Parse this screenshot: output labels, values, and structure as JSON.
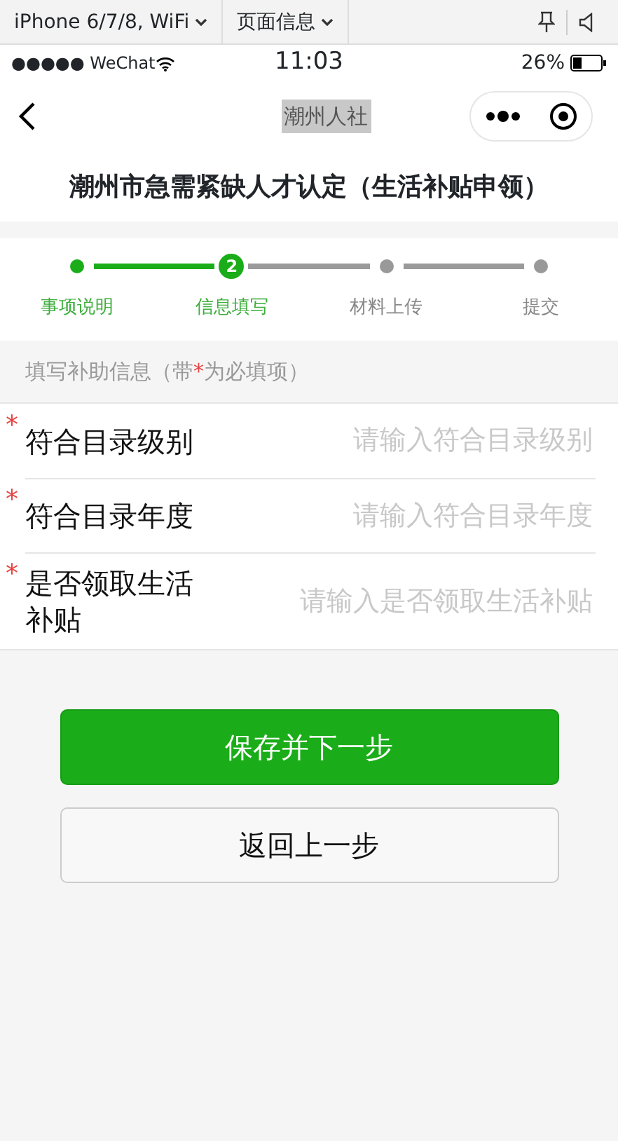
{
  "devtools_bar": {
    "device": "iPhone 6/7/8, WiFi",
    "page_info": "页面信息"
  },
  "status_bar": {
    "carrier": "●●●●● WeChat",
    "time": "11:03",
    "battery": "26%"
  },
  "nav_bar": {
    "title": "潮州人社"
  },
  "page_title": "潮州市急需紧缺人才认定（生活补贴申领）",
  "steps": [
    {
      "label": "事项说明",
      "completed": true,
      "selected": false
    },
    {
      "label": "信息填写",
      "completed": false,
      "selected": true,
      "number": "2"
    },
    {
      "label": "材料上传",
      "completed": false,
      "selected": false
    },
    {
      "label": "提交",
      "completed": false,
      "selected": false
    }
  ],
  "section_header": {
    "before": "填写补助信息（带",
    "mark": "*",
    "after": "为必填项）"
  },
  "fields": [
    {
      "label": "符合目录级别",
      "required": true,
      "placeholder": "请输入符合目录级别"
    },
    {
      "label": "符合目录年度",
      "required": true,
      "placeholder": "请输入符合目录年度"
    },
    {
      "label": "是否领取生活补贴",
      "required": true,
      "placeholder": "请输入是否领取生活补贴"
    }
  ],
  "buttons": [
    {
      "label": "保存并下一步",
      "kind": "primary"
    },
    {
      "label": "返回上一步",
      "kind": "secondary"
    }
  ]
}
